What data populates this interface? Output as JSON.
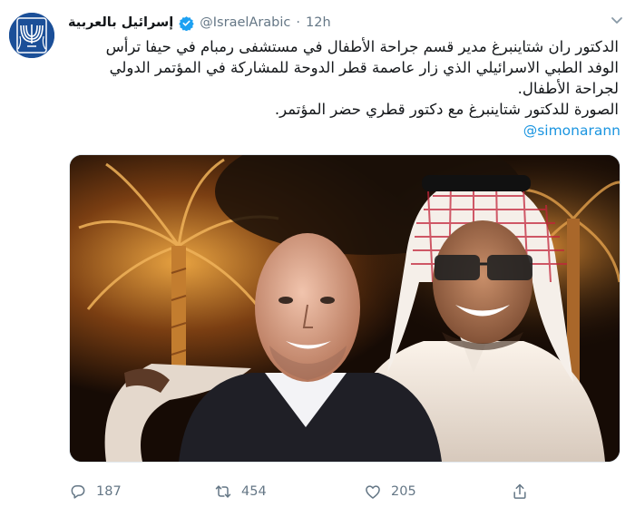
{
  "account": {
    "name": "إسرائيل بالعربية",
    "handle": "@IsraelArabic",
    "separator": "·",
    "time": "12h"
  },
  "tweet": {
    "text_lines": [
      "الدكتور ران شتاينبرغ مدير قسم جراحة الأطفال في مستشفى رمبام في حيفا ترأس",
      "الوفد الطبي الاسرائيلي الذي زار عاصمة قطر الدوحة للمشاركة في المؤتمر الدولي",
      "لجراحة الأطفال.",
      "الصورة للدكتور شتاينبرغ مع دكتور قطري حضر المؤتمر."
    ],
    "mention": "@simonarann"
  },
  "actions": {
    "replies": "187",
    "retweets": "454",
    "likes": "205"
  },
  "icons": {
    "avatar": "menorah-emblem-icon",
    "verified": "verified-badge-icon",
    "more": "chevron-down-icon",
    "reply": "reply-icon",
    "retweet": "retweet-icon",
    "like": "heart-icon",
    "share": "share-icon"
  },
  "colors": {
    "link": "#1b95e0",
    "muted": "#657786",
    "verified": "#1da1f2",
    "avatar_bg": "#1b4f98"
  }
}
